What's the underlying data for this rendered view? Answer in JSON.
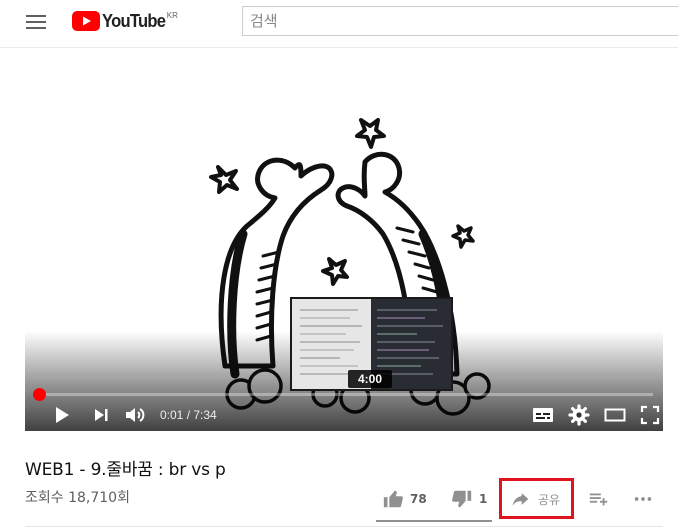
{
  "masthead": {
    "logo_text": "YouTube",
    "logo_region": "KR",
    "search_placeholder": "검색"
  },
  "player": {
    "preview_time": "4:00",
    "current_time": "0:01",
    "time_separator": " / ",
    "duration": "7:34",
    "progress_fraction": 0.002,
    "icons": [
      "play-icon",
      "next-icon",
      "volume-icon",
      "subtitles-icon",
      "settings-icon",
      "theater-icon",
      "fullscreen-icon"
    ]
  },
  "video": {
    "title": "WEB1 - 9.줄바꿈 : br vs p",
    "views": "조회수 18,710회"
  },
  "actions": {
    "like_count": "78",
    "dislike_count": "1",
    "share_label": "공유"
  },
  "colors": {
    "accent": "#ff0000",
    "highlight": "#e0141e"
  }
}
